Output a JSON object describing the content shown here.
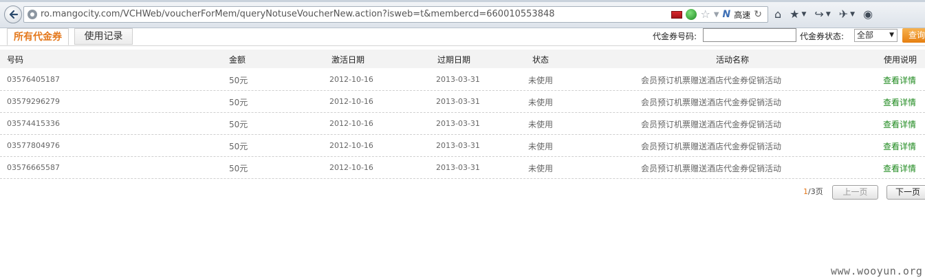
{
  "browser": {
    "url": "ro.mangocity.com/VCHWeb/voucherForMem/queryNotuseVoucherNew.action?isweb=t&membercd=660010553848",
    "speed_label": "高速"
  },
  "page": {
    "tabs": [
      {
        "label": "所有代金券",
        "active": true
      },
      {
        "label": "使用记录",
        "active": false
      }
    ],
    "filter": {
      "code_label": "代金券号码:",
      "code_value": "",
      "status_label": "代金券状态:",
      "status_selected": "全部",
      "query_label": "查询"
    },
    "columns": [
      "号码",
      "金额",
      "激活日期",
      "过期日期",
      "状态",
      "活动名称",
      "使用说明"
    ],
    "rows": [
      {
        "code": "03576405187",
        "amount": "50元",
        "activated": "2012-10-16",
        "expires": "2013-03-31",
        "status": "未使用",
        "campaign": "会员预订机票赠送酒店代金券促销活动",
        "link": "查看详情"
      },
      {
        "code": "03579296279",
        "amount": "50元",
        "activated": "2012-10-16",
        "expires": "2013-03-31",
        "status": "未使用",
        "campaign": "会员预订机票赠送酒店代金券促销活动",
        "link": "查看详情"
      },
      {
        "code": "03574415336",
        "amount": "50元",
        "activated": "2012-10-16",
        "expires": "2013-03-31",
        "status": "未使用",
        "campaign": "会员预订机票赠送酒店代金券促销活动",
        "link": "查看详情"
      },
      {
        "code": "03577804976",
        "amount": "50元",
        "activated": "2012-10-16",
        "expires": "2013-03-31",
        "status": "未使用",
        "campaign": "会员预订机票赠送酒店代金券促销活动",
        "link": "查看详情"
      },
      {
        "code": "03576665587",
        "amount": "50元",
        "activated": "2012-10-16",
        "expires": "2013-03-31",
        "status": "未使用",
        "campaign": "会员预订机票赠送酒店代金券促销活动",
        "link": "查看详情"
      }
    ],
    "pager": {
      "current": "1",
      "total_text": "/3页",
      "prev_label": "上一页",
      "next_label": "下一页"
    }
  },
  "watermark": "www.wooyun.org",
  "colors": {
    "accent": "#e4781c",
    "link": "#1f8a1f"
  }
}
